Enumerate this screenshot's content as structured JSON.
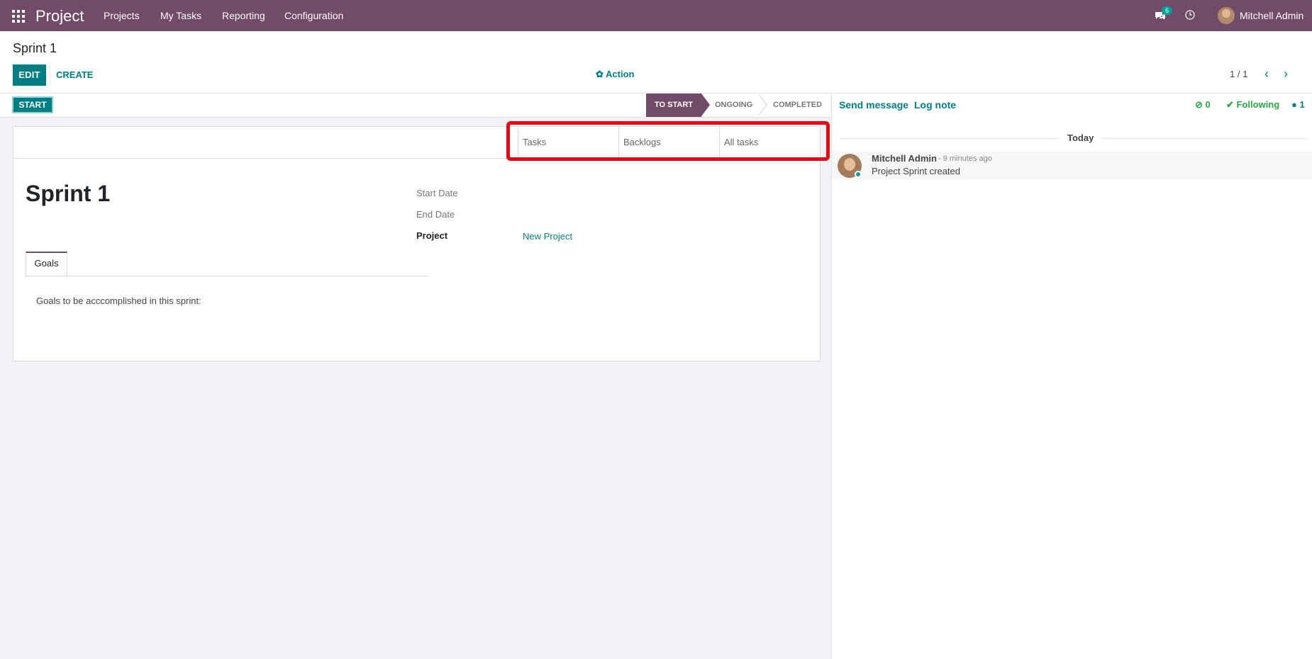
{
  "topnav": {
    "brand": "Project",
    "menu": [
      "Projects",
      "My Tasks",
      "Reporting",
      "Configuration"
    ],
    "messages_count": "6",
    "user": "Mitchell Admin",
    "bg_color": "#714b67"
  },
  "control": {
    "breadcrumb": "Sprint 1",
    "edit_label": "EDIT",
    "create_label": "CREATE",
    "action_label": "Action",
    "pager": "1 / 1"
  },
  "statusbar": {
    "start_label": "START",
    "stages": [
      "TO START",
      "ONGOING",
      "COMPLETED"
    ],
    "active_stage": "TO START"
  },
  "smart_buttons": [
    "Tasks",
    "Backlogs",
    "All tasks"
  ],
  "form": {
    "title": "Sprint 1",
    "start_date_label": "Start Date",
    "end_date_label": "End Date",
    "project_label": "Project",
    "project_value": "New Project",
    "tab_label": "Goals",
    "goals_text": "Goals to be acccomplished in this sprint:"
  },
  "chatter": {
    "send_message": "Send message",
    "log_note": "Log note",
    "attachments": "0",
    "following": "Following",
    "followers": "1",
    "today": "Today",
    "message": {
      "author": "Mitchell Admin",
      "time": "- 9 minutes ago",
      "body": "Project Sprint created"
    }
  },
  "colors": {
    "accent": "#017e84",
    "highlight": "#e50914",
    "success": "#28a745"
  }
}
